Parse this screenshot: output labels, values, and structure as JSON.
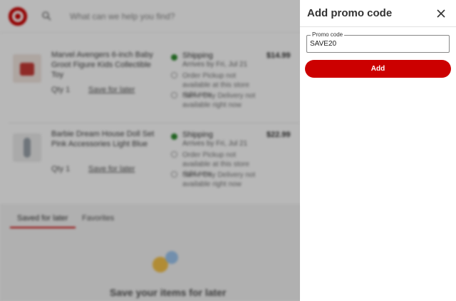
{
  "background": {
    "search_placeholder": "What can we help you find?",
    "items": [
      {
        "title": "Marvel Avengers 6-inch Baby Groot Figure Kids Collectible Toy",
        "qty": "Qty 1",
        "save_link": "Save for later",
        "shipping_title": "Shipping",
        "shipping_sub": "Arrives by Fri, Jul 21",
        "option1": "Order Pickup not available at this store right now",
        "option2": "Same Day Delivery not available right now",
        "price": "$14.99"
      },
      {
        "title": "Barbie Dream House Doll Set Pink Accessories Light Blue",
        "qty": "Qty 1",
        "save_link": "Save for later",
        "shipping_title": "Shipping",
        "shipping_sub": "Arrives by Fri, Jul 21",
        "option1": "Order Pickup not available at this store right now",
        "option2": "Same Day Delivery not available right now",
        "price": "$22.99"
      }
    ],
    "tabs": [
      "Saved for later",
      "Favorites"
    ],
    "save_headline": "Save your items for later"
  },
  "panel": {
    "title": "Add promo code",
    "field_label": "Promo code",
    "field_value": "SAVE20",
    "add_label": "Add"
  },
  "colors": {
    "brand_red": "#cc0000",
    "ship_green": "#2e8b2e"
  },
  "icons": {
    "close": "close-icon",
    "search": "search-icon",
    "logo": "target-logo"
  }
}
